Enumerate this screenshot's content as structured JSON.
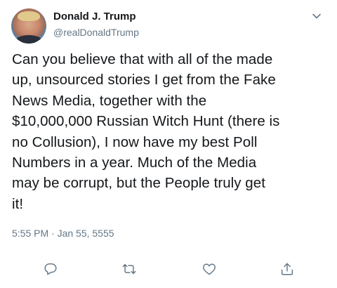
{
  "author": {
    "name": "Donald J. Trump",
    "handle": "@realDonaldTrump"
  },
  "tweet": {
    "lines": [
      "Can you believe that with all of the made",
      "up, unsourced stories I get from the Fake",
      "News Media, together with the",
      "$10,000,000 Russian Witch Hunt (there is",
      "no Collusion), I now have my best Poll",
      "Numbers in a year. Much of the Media",
      "may be corrupt, but the People truly get",
      "it!"
    ],
    "timestamp": "5:55 PM · Jan 55, 5555"
  },
  "icons": {
    "caret": "chevron-down-icon",
    "reply": "reply-icon",
    "retweet": "retweet-icon",
    "like": "heart-icon",
    "share": "share-icon"
  },
  "colors": {
    "text": "#14171a",
    "secondary": "#657786"
  }
}
